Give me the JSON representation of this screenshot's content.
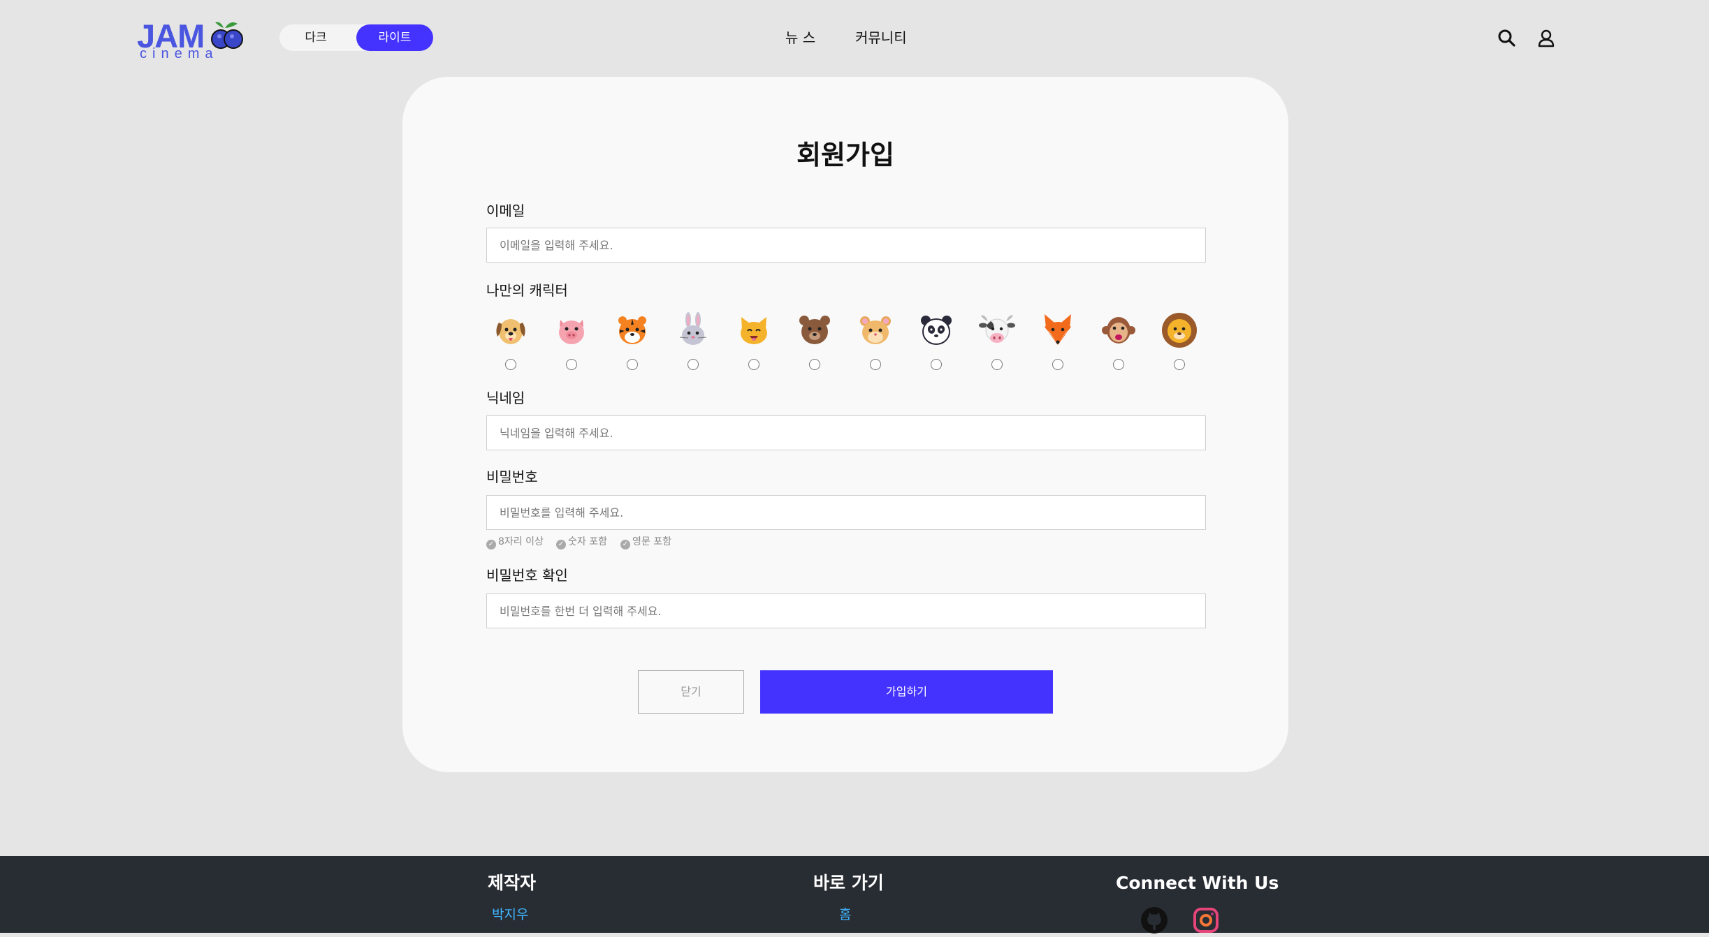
{
  "header": {
    "logo_text": "JAM",
    "logo_sub": "cinema",
    "theme": {
      "dark_label": "다크",
      "light_label": "라이트",
      "selected": "라이트"
    },
    "nav": {
      "news": "뉴 스",
      "community": "커뮤니티"
    },
    "icons": {
      "search": "search-icon",
      "user": "user-icon"
    }
  },
  "form": {
    "title": "회원가입",
    "email": {
      "label": "이메일",
      "placeholder": "이메일을 입력해 주세요."
    },
    "character": {
      "label": "나만의 캐릭터",
      "options": [
        "dog",
        "pig",
        "tiger",
        "rabbit",
        "cat",
        "bear",
        "hamster",
        "panda",
        "cow",
        "fox",
        "monkey",
        "lion"
      ]
    },
    "nickname": {
      "label": "닉네임",
      "placeholder": "닉네임을 입력해 주세요."
    },
    "password": {
      "label": "비밀번호",
      "placeholder": "비밀번호를 입력해 주세요.",
      "rules": [
        "8자리 이상",
        "숫자 포함",
        "영문 포함"
      ]
    },
    "password_confirm": {
      "label": "비밀번호 확인",
      "placeholder": "비밀번호를 한번 더 입력해 주세요."
    },
    "buttons": {
      "close": "닫기",
      "submit": "가입하기"
    }
  },
  "footer": {
    "maker": {
      "heading": "제작자",
      "link": "박지우"
    },
    "shortcut": {
      "heading": "바로 가기",
      "link": "홈"
    },
    "connect": {
      "heading": "Connect With Us",
      "icons": [
        "github-icon",
        "instagram-icon"
      ]
    }
  },
  "colors": {
    "accent": "#4433ff",
    "logo": "#4a55e0",
    "background": "#e5e5e5",
    "card": "#f9f9f9",
    "footer": "#282c33",
    "link": "#3fb6ff"
  }
}
